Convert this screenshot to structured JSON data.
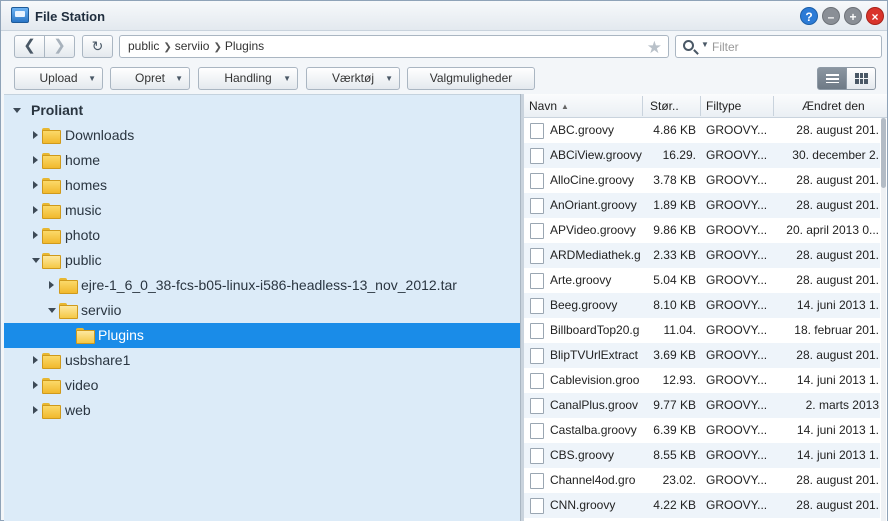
{
  "window": {
    "title": "File Station"
  },
  "path": {
    "crumbs": [
      "public",
      "serviio",
      "Plugins"
    ]
  },
  "search": {
    "placeholder": "Filter"
  },
  "toolbar": {
    "upload": "Upload",
    "opret": "Opret",
    "handling": "Handling",
    "vaerktoej": "Værktøj",
    "valgmuligheder": "Valgmuligheder"
  },
  "tree": {
    "root": "Proliant",
    "items": [
      {
        "label": "Downloads",
        "level": 1,
        "expanded": false
      },
      {
        "label": "home",
        "level": 1,
        "expanded": false
      },
      {
        "label": "homes",
        "level": 1,
        "expanded": false
      },
      {
        "label": "music",
        "level": 1,
        "expanded": false
      },
      {
        "label": "photo",
        "level": 1,
        "expanded": false
      },
      {
        "label": "public",
        "level": 1,
        "expanded": true
      },
      {
        "label": "ejre-1_6_0_38-fcs-b05-linux-i586-headless-13_nov_2012.tar",
        "level": 2,
        "expanded": false
      },
      {
        "label": "serviio",
        "level": 2,
        "expanded": true
      },
      {
        "label": "Plugins",
        "level": 3,
        "selected": true
      },
      {
        "label": "usbshare1",
        "level": 1,
        "expanded": false
      },
      {
        "label": "video",
        "level": 1,
        "expanded": false
      },
      {
        "label": "web",
        "level": 1,
        "expanded": false
      }
    ]
  },
  "filelist": {
    "columns": {
      "name": "Navn",
      "size": "Stør..",
      "type": "Filtype",
      "modified": "Ændret den"
    },
    "rows": [
      {
        "name": "ABC.groovy",
        "size": "4.86 KB",
        "type": "GROOVY...",
        "modified": "28. august 201."
      },
      {
        "name": "ABCiView.groovy",
        "size": "16.29.",
        "type": "GROOVY...",
        "modified": "30. december 2."
      },
      {
        "name": "AlloCine.groovy",
        "size": "3.78 KB",
        "type": "GROOVY...",
        "modified": "28. august 201."
      },
      {
        "name": "AnOriant.groovy",
        "size": "1.89 KB",
        "type": "GROOVY...",
        "modified": "28. august 201."
      },
      {
        "name": "APVideo.groovy",
        "size": "9.86 KB",
        "type": "GROOVY...",
        "modified": "20. april 2013 0..."
      },
      {
        "name": "ARDMediathek.g",
        "size": "2.33 KB",
        "type": "GROOVY...",
        "modified": "28. august 201."
      },
      {
        "name": "Arte.groovy",
        "size": "5.04 KB",
        "type": "GROOVY...",
        "modified": "28. august 201."
      },
      {
        "name": "Beeg.groovy",
        "size": "8.10 KB",
        "type": "GROOVY...",
        "modified": "14. juni 2013 1."
      },
      {
        "name": "BillboardTop20.g",
        "size": "11.04.",
        "type": "GROOVY...",
        "modified": "18. februar 201."
      },
      {
        "name": "BlipTVUrlExtract",
        "size": "3.69 KB",
        "type": "GROOVY...",
        "modified": "28. august 201."
      },
      {
        "name": "Cablevision.groo",
        "size": "12.93.",
        "type": "GROOVY...",
        "modified": "14. juni 2013 1."
      },
      {
        "name": "CanalPlus.groov",
        "size": "9.77 KB",
        "type": "GROOVY...",
        "modified": "2. marts 2013"
      },
      {
        "name": "Castalba.groovy",
        "size": "6.39 KB",
        "type": "GROOVY...",
        "modified": "14. juni 2013 1."
      },
      {
        "name": "CBS.groovy",
        "size": "8.55 KB",
        "type": "GROOVY...",
        "modified": "14. juni 2013 1."
      },
      {
        "name": "Channel4od.gro",
        "size": "23.02.",
        "type": "GROOVY...",
        "modified": "28. august 201."
      },
      {
        "name": "CNN.groovy",
        "size": "4.22 KB",
        "type": "GROOVY...",
        "modified": "28. august 201."
      }
    ]
  }
}
